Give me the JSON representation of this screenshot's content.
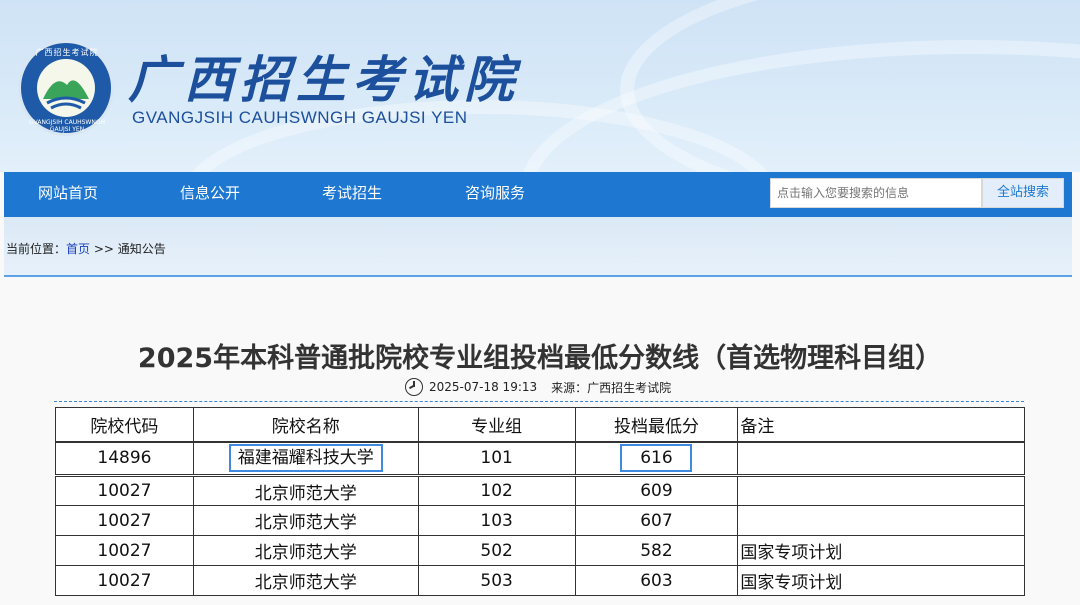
{
  "header": {
    "title_cn": "广西招生考试院",
    "title_en": "GVANGJSIH CAUHSWNGH GAUJSI YEN",
    "logo_ring_text": "广西招生考试院",
    "logo_ring_text_en": "GVANGJSIH CAUHSWNGH GAUJSI YEN"
  },
  "nav": {
    "items": [
      "网站首页",
      "信息公开",
      "考试招生",
      "咨询服务"
    ],
    "search_placeholder": "点击输入您要搜索的信息",
    "search_button": "全站搜索"
  },
  "breadcrumb": {
    "prefix": "当前位置：",
    "home": "首页",
    "sep": " >> ",
    "current": "通知公告"
  },
  "article": {
    "title": "2025年本科普通批院校专业组投档最低分数线（首选物理科目组）",
    "datetime": "2025-07-18 19:13",
    "source": "来源：广西招生考试院"
  },
  "table": {
    "headers": [
      "院校代码",
      "院校名称",
      "专业组",
      "投档最低分",
      "备注"
    ],
    "rows": [
      {
        "code": "14896",
        "name": "福建福耀科技大学",
        "group": "101",
        "score": "616",
        "note": ""
      },
      {
        "code": "10027",
        "name": "北京师范大学",
        "group": "102",
        "score": "609",
        "note": ""
      },
      {
        "code": "10027",
        "name": "北京师范大学",
        "group": "103",
        "score": "607",
        "note": ""
      },
      {
        "code": "10027",
        "name": "北京师范大学",
        "group": "502",
        "score": "582",
        "note": "国家专项计划"
      },
      {
        "code": "10027",
        "name": "北京师范大学",
        "group": "503",
        "score": "603",
        "note": "国家专项计划"
      }
    ]
  },
  "colors": {
    "nav_bg": "#1e78d2",
    "title_blue": "#1c4f9c",
    "highlight_border": "#3d8ae0"
  }
}
